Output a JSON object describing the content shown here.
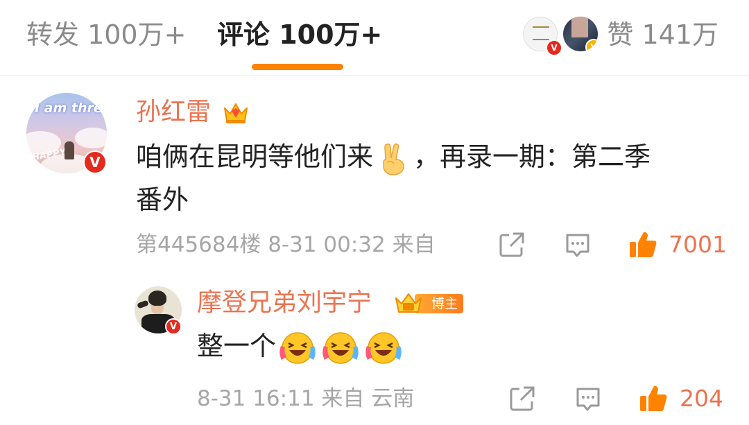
{
  "tabs": {
    "repost": "转发 100万+",
    "comment": "评论 100万+",
    "like": "赞 141万"
  },
  "colors": {
    "accent": "#ff8200",
    "username": "#eb7350",
    "meta": "#a6a6a6",
    "text": "#222222"
  },
  "comments": [
    {
      "username": "孙红雷",
      "text_line1_before_emoji": "咱俩在昆明等他们来",
      "text_line1_after_emoji": "，再录一期：第二季",
      "text_line2": "番外",
      "meta": "第445684楼 8-31 00:32 来自",
      "likes": "7001",
      "badge_icon": "crown-member-icon",
      "emoji": "victory-hand-emoji",
      "avatar_text": "I am three",
      "avatar_text2": "HAPPY"
    },
    {
      "username": "摩登兄弟刘宇宁",
      "text_before_emoji": "整一个",
      "meta": "8-31 16:11 来自 云南",
      "likes": "204",
      "badge_label": "博主",
      "badge_icon": "fan-crown-icon",
      "emoji": "laughing-crying-emoji"
    }
  ],
  "icons": {
    "share": "share-icon",
    "comment": "comment-icon",
    "like": "thumbs-up-icon",
    "verified": "verified-v-icon"
  }
}
